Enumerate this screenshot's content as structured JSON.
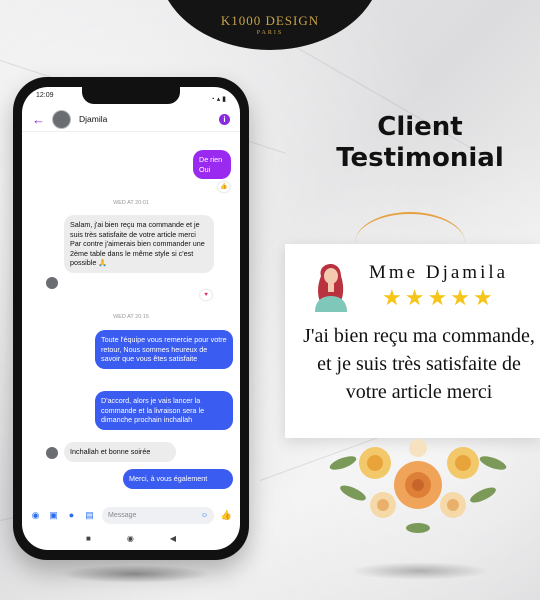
{
  "logo": {
    "name": "K1000 DESIGN",
    "sub": "PARIS"
  },
  "phone": {
    "status": {
      "time": "12:09",
      "icons": "◔ ▴ ▮"
    },
    "header": {
      "contact": "Djamila"
    },
    "messages": {
      "m1": "De rien Oui",
      "ts1": "WED AT 20:01",
      "m2": "Salam, j'ai bien reçu ma commande et je suis très satisfaite de votre article merci Par contre j'aimerais bien commander une 2ème table dans le même style si c'est possible 🙏",
      "ts2": "WED AT 20:15",
      "m3": "Toute l'équipe vous remercie pour votre retour, Nous sommes heureux de savoir que vous êtes satisfaite",
      "m4": "D'accord, alors je vais lancer la commande et la livraison sera le dimanche prochain inchallah",
      "m5": "Inchallah et bonne soirée",
      "m6": "Merci, à vous également"
    },
    "composer": {
      "placeholder": "Message"
    }
  },
  "title": {
    "line1": "Client",
    "line2": "Testimonial"
  },
  "card": {
    "reviewer": "Mme Djamila",
    "rating": 5,
    "review": "J'ai bien reçu ma commande, et je suis très satisfaite de votre article merci"
  },
  "colors": {
    "accent_purple": "#9b2af0",
    "accent_blue": "#3a5cf0",
    "star": "#f5c518",
    "gold": "#c8a24a"
  }
}
